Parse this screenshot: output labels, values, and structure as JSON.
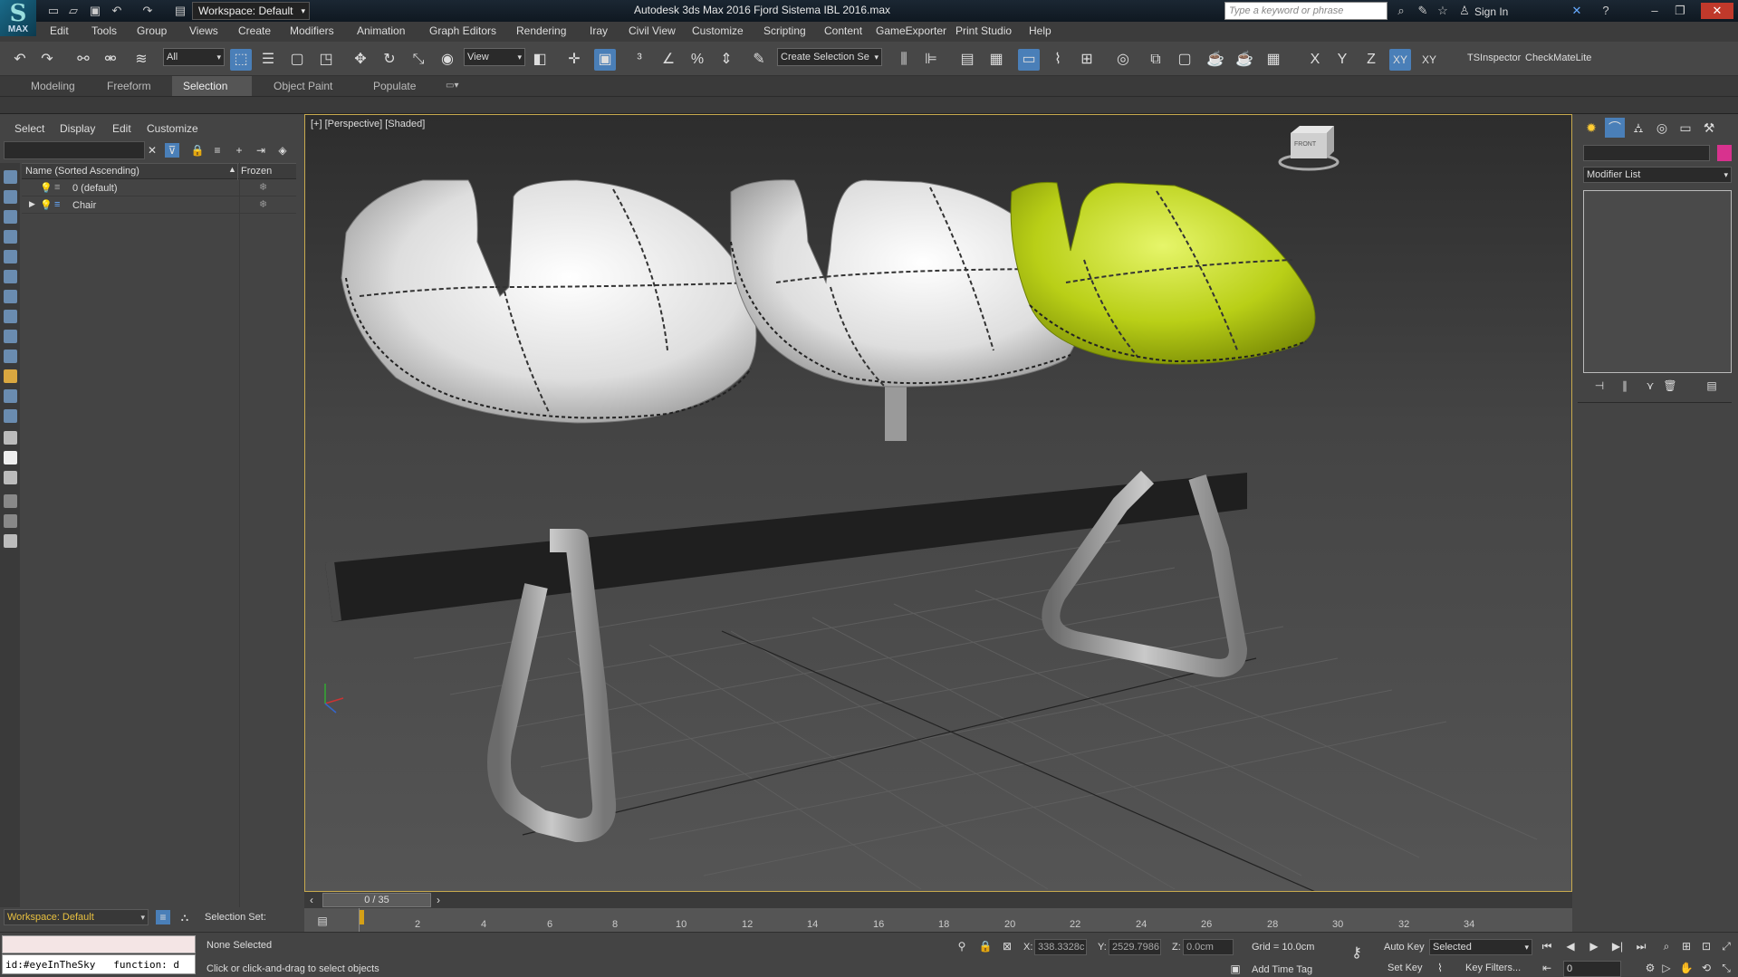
{
  "app": {
    "logo_text": "MAX",
    "title": "Autodesk 3ds Max 2016     Fjord Sistema IBL 2016.max",
    "workspace": "Workspace: Default",
    "search_placeholder": "Type a keyword or phrase",
    "sign_in": "Sign In"
  },
  "menu": [
    "Edit",
    "Tools",
    "Group",
    "Views",
    "Create",
    "Modifiers",
    "Animation",
    "Graph Editors",
    "Rendering",
    "Iray",
    "Civil View",
    "Customize",
    "Scripting",
    "Content",
    "GameExporter",
    "Print Studio",
    "Help"
  ],
  "toolbar": {
    "filter": "All",
    "ref_coord": "View",
    "selection_set": "Create Selection Se",
    "axes": [
      "X",
      "Y",
      "Z",
      "XY",
      "XY"
    ],
    "plugins": [
      "TSInspector",
      "CheckMateLite"
    ]
  },
  "ribbon": {
    "tabs": [
      "Modeling",
      "Freeform",
      "Selection",
      "Object Paint",
      "Populate"
    ],
    "active": "Selection"
  },
  "scene_explorer": {
    "menu": [
      "Select",
      "Display",
      "Edit",
      "Customize"
    ],
    "col_name": "Name (Sorted Ascending)",
    "col_frozen": "Frozen",
    "rows": [
      {
        "name": "0 (default)"
      },
      {
        "name": "Chair"
      }
    ]
  },
  "viewport": {
    "label": "[+] [Perspective] [Shaded]",
    "viewcube": "FRONT"
  },
  "command_panel": {
    "modifier_list": "Modifier List",
    "color": "#d8328e"
  },
  "timeline": {
    "counter": "0 / 35",
    "ticks": [
      "2",
      "4",
      "6",
      "8",
      "10",
      "12",
      "14",
      "16",
      "18",
      "20",
      "22",
      "24",
      "26",
      "28",
      "30",
      "32",
      "34"
    ]
  },
  "status": {
    "workspace": "Workspace: Default",
    "selection_set": "Selection Set:",
    "maxscript": "id:#eyeInTheSky   function: d",
    "none_selected": "None Selected",
    "prompt": "Click or click-and-drag to select objects",
    "x_label": "X:",
    "x_value": "338.3328c",
    "y_label": "Y:",
    "y_value": "2529.7986",
    "z_label": "Z:",
    "z_value": "0.0cm",
    "grid": "Grid = 10.0cm",
    "add_time_tag": "Add Time Tag",
    "auto_key": "Auto Key",
    "key_mode": "Selected",
    "set_key": "Set Key",
    "key_filters": "Key Filters...",
    "frame": "0"
  }
}
